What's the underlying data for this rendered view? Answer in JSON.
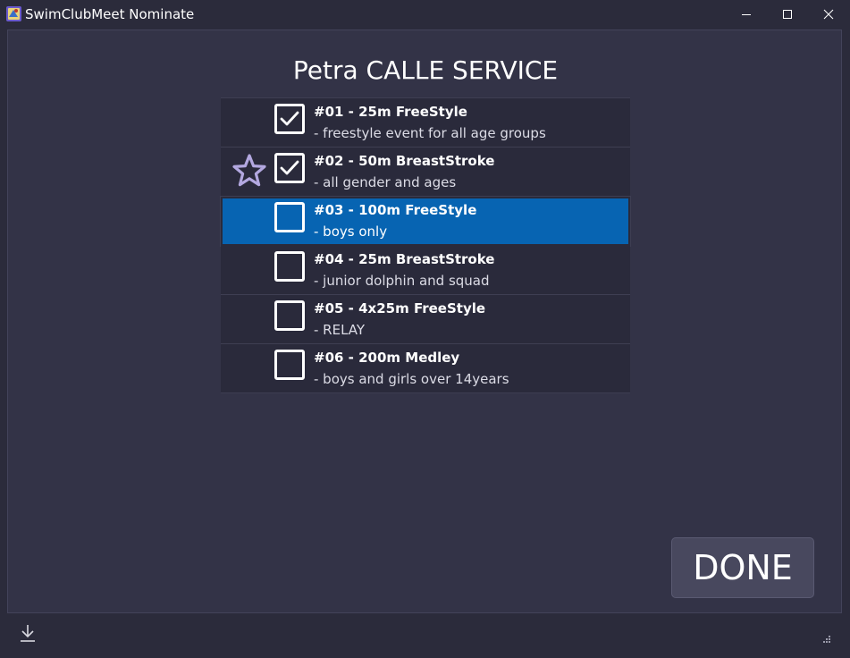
{
  "window": {
    "title": "SwimClubMeet Nominate",
    "icons": {
      "app": "app-logo-icon",
      "minimize": "minimize-icon",
      "maximize": "maximize-icon",
      "close": "close-icon"
    }
  },
  "member": {
    "name": "Petra CALLE SERVICE"
  },
  "events": [
    {
      "title": "#01 - 25m FreeStyle",
      "description": "- freestyle event for all age groups",
      "checked": true,
      "starred": false,
      "selected": false
    },
    {
      "title": "#02 - 50m BreastStroke",
      "description": "- all gender and ages",
      "checked": true,
      "starred": true,
      "selected": false
    },
    {
      "title": "#03 - 100m FreeStyle",
      "description": "- boys only",
      "checked": false,
      "starred": false,
      "selected": true
    },
    {
      "title": "#04 - 25m BreastStroke",
      "description": "- junior dolphin and squad",
      "checked": false,
      "starred": false,
      "selected": false
    },
    {
      "title": "#05 - 4x25m FreeStyle",
      "description": "- RELAY",
      "checked": false,
      "starred": false,
      "selected": false
    },
    {
      "title": "#06 - 200m Medley",
      "description": "- boys and girls over 14years",
      "checked": false,
      "starred": false,
      "selected": false
    }
  ],
  "actions": {
    "done_label": "DONE"
  },
  "colors": {
    "background": "#2b2b3b",
    "panel": "#333347",
    "row": "#2a2a3b",
    "selected": "#0764b2",
    "star": "#b3a8e0",
    "text": "#ffffff"
  },
  "statusbar": {
    "icons": {
      "download": "download-icon",
      "grip": "resize-grip-icon"
    }
  }
}
